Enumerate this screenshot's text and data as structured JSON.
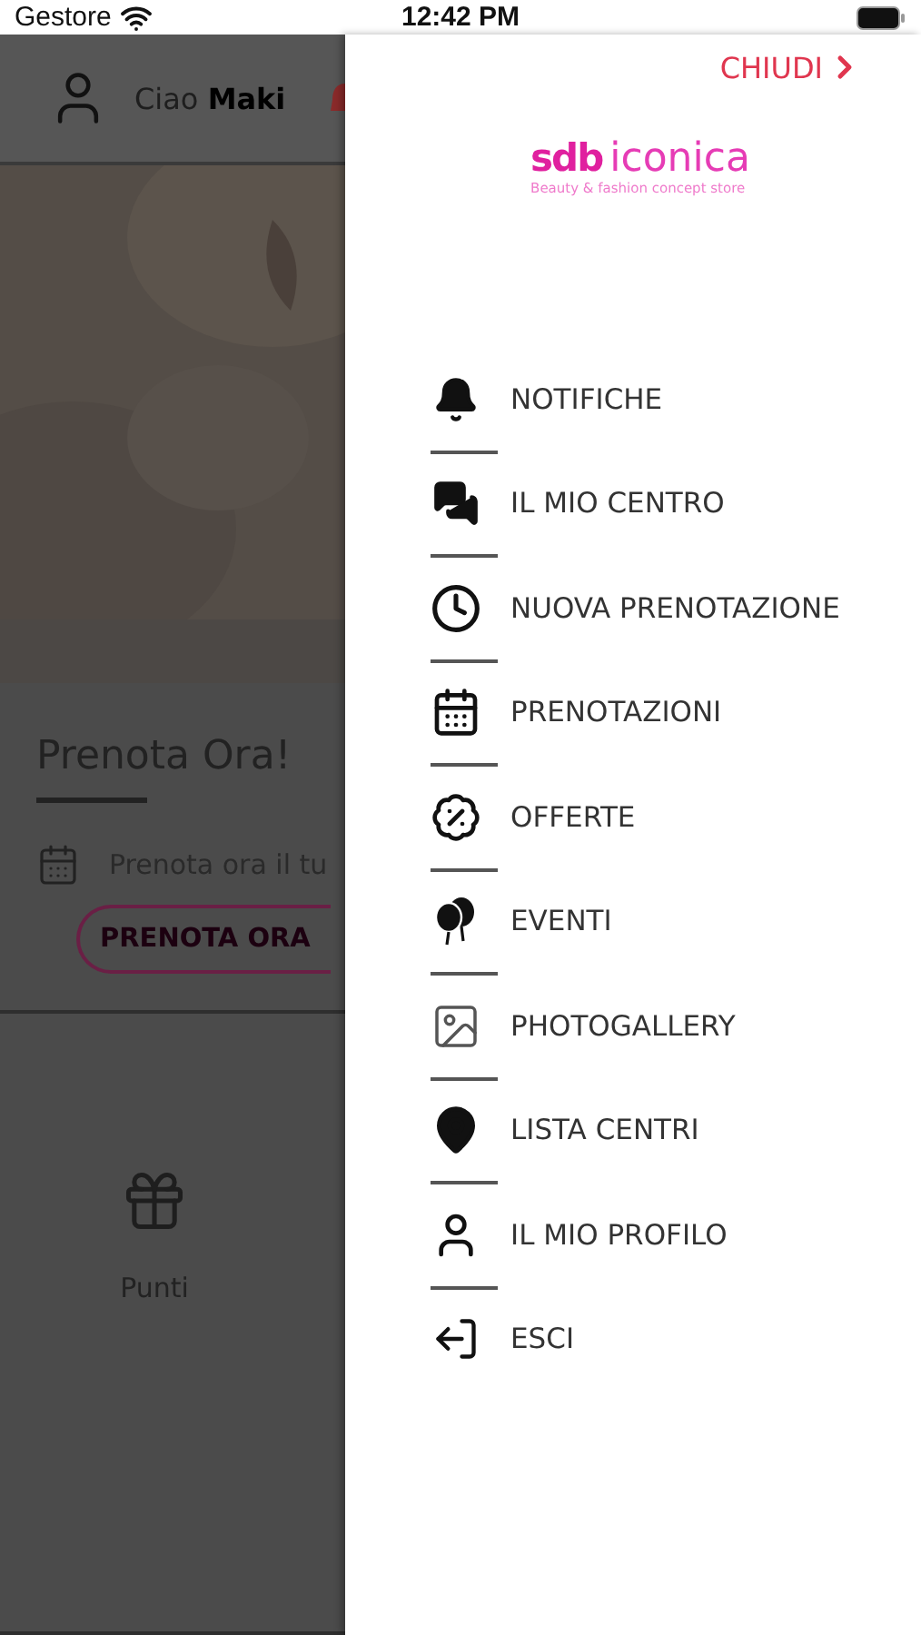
{
  "status_bar": {
    "carrier": "Gestore",
    "time": "12:42 PM"
  },
  "background": {
    "greeting": "Ciao",
    "user": "Maki",
    "section_title": "Prenota Ora!",
    "section_text": "Prenota ora il tu",
    "book_button": "PRENOTA ORA",
    "points_label": "Punti"
  },
  "drawer": {
    "close": "CHIUDI",
    "logo_mark": "sdb",
    "logo_name": "iconica",
    "logo_tagline": "Beauty & fashion concept store",
    "items": [
      {
        "label": "NOTIFICHE"
      },
      {
        "label": "IL MIO CENTRO"
      },
      {
        "label": "NUOVA PRENOTAZIONE"
      },
      {
        "label": "PRENOTAZIONI"
      },
      {
        "label": "OFFERTE"
      },
      {
        "label": "EVENTI"
      },
      {
        "label": "PHOTOGALLERY"
      },
      {
        "label": "LISTA CENTRI"
      },
      {
        "label": "IL MIO PROFILO"
      },
      {
        "label": "ESCI"
      }
    ]
  }
}
